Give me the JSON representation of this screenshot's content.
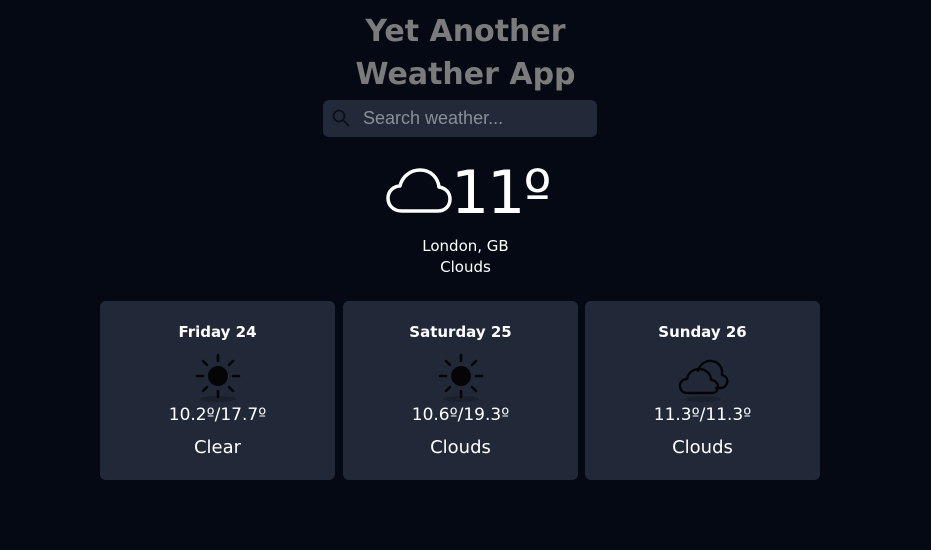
{
  "app": {
    "title_line1": "Yet Another",
    "title_line2": "Weather App"
  },
  "search": {
    "placeholder": "Search weather...",
    "value": "",
    "icon": "search-icon"
  },
  "current": {
    "icon": "cloud-icon",
    "temperature": "11º",
    "location": "London, GB",
    "condition": "Clouds"
  },
  "forecast": [
    {
      "day": "Friday 24",
      "icon": "sun-icon",
      "range": "10.2º/17.7º",
      "condition": "Clear"
    },
    {
      "day": "Saturday 25",
      "icon": "sun-icon",
      "range": "10.6º/19.3º",
      "condition": "Clouds"
    },
    {
      "day": "Sunday 26",
      "icon": "clouds-icon",
      "range": "11.3º/11.3º",
      "condition": "Clouds"
    }
  ],
  "colors": {
    "background": "#050914",
    "card": "#212938",
    "search_bg": "#222a3a",
    "title": "#7b7b7b"
  }
}
